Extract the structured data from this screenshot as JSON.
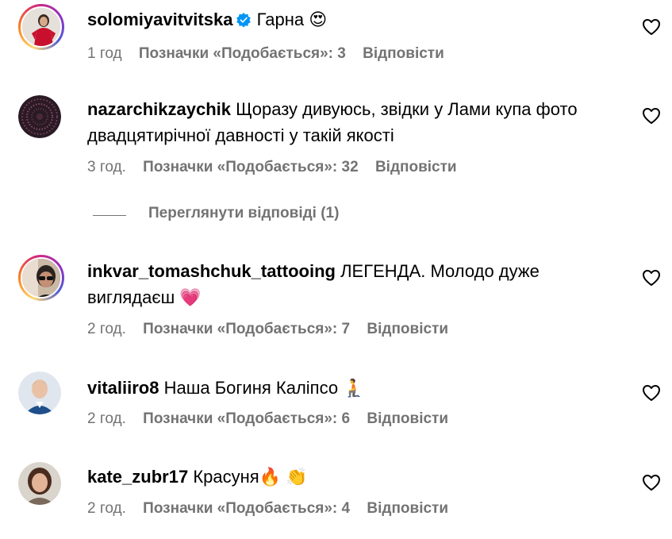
{
  "comments": [
    {
      "username": "solomiyavitvitska",
      "verified": true,
      "text": "Гарна 😍",
      "text_line2": "",
      "time": "1 год",
      "likes": "Позначки «Подобається»: 3",
      "reply": "Відповісти",
      "avatar_icon": "woman-red-dress-avatar"
    },
    {
      "username": "nazarchikzaychik",
      "verified": false,
      "text": "Щоразу дивуюсь, звідки у Лами купа фото",
      "text_line2": "двадцятирічної давності у такій якості",
      "time": "3 год.",
      "likes": "Позначки «Подобається»: 32",
      "reply": "Відповісти",
      "avatar_icon": "dark-pattern-avatar"
    },
    {
      "username": "inkvar_tomashchuk_tattooing",
      "verified": false,
      "text": "ЛЕГЕНДА. Молодо дуже",
      "text_line2": "виглядаєш 💗",
      "time": "2 год.",
      "likes": "Позначки «Подобається»: 7",
      "reply": "Відповісти",
      "avatar_icon": "man-sunglasses-avatar"
    },
    {
      "username": "vitaliiro8",
      "verified": false,
      "text": "Наша Богиня Каліпсо 🧎",
      "text_line2": "",
      "time": "2 год.",
      "likes": "Позначки «Подобається»: 6",
      "reply": "Відповісти",
      "avatar_icon": "man-portrait-avatar"
    },
    {
      "username": "kate_zubr17",
      "verified": false,
      "text": "Красуня🔥 👏",
      "text_line2": "",
      "time": "2 год.",
      "likes": "Позначки «Подобається»: 4",
      "reply": "Відповісти",
      "avatar_icon": "woman-portrait-avatar"
    }
  ],
  "view_replies": "Переглянути відповіді (1)",
  "colors": {
    "meta_text": "#737373",
    "verified_badge": "#0095f6",
    "heart_stroke": "#000000"
  }
}
